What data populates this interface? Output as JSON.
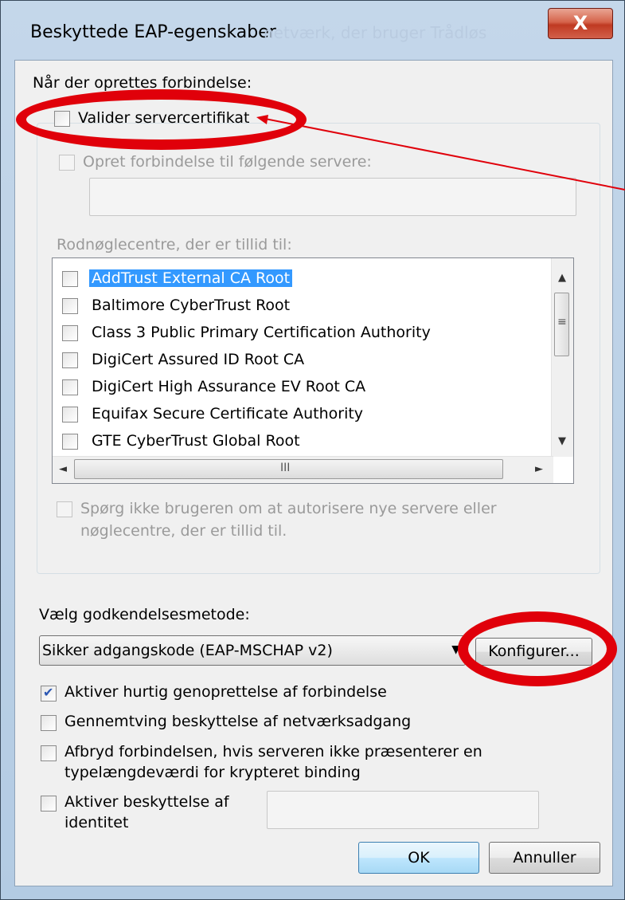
{
  "window": {
    "title": "Beskyttede EAP-egenskaber",
    "close_label": "X",
    "background_hint": "netværk, der bruger Trådløs"
  },
  "connect_section": {
    "heading": "Når der oprettes forbindelse:",
    "validate_cert": {
      "label": "Valider servercertifikat",
      "checked": false
    },
    "connect_servers": {
      "label": "Opret forbindelse til følgende servere:",
      "checked": false,
      "value": ""
    },
    "root_ca_label": "Rodnøglecentre, der er tillid til:",
    "root_cas": [
      {
        "label": "AddTrust External CA Root",
        "checked": false,
        "selected": true
      },
      {
        "label": "Baltimore CyberTrust Root",
        "checked": false,
        "selected": false
      },
      {
        "label": "Class 3 Public Primary Certification Authority",
        "checked": false,
        "selected": false
      },
      {
        "label": "DigiCert Assured ID Root CA",
        "checked": false,
        "selected": false
      },
      {
        "label": "DigiCert High Assurance EV Root CA",
        "checked": false,
        "selected": false
      },
      {
        "label": "Equifax Secure Certificate Authority",
        "checked": false,
        "selected": false
      },
      {
        "label": "GTE CyberTrust Global Root",
        "checked": false,
        "selected": false
      }
    ],
    "dont_prompt": {
      "line1": "Spørg ikke brugeren om at autorisere nye servere eller",
      "line2": "nøglecentre, der er tillid til.",
      "checked": false
    }
  },
  "auth_method": {
    "label": "Vælg godkendelsesmetode:",
    "selected": "Sikker adgangskode (EAP-MSCHAP v2)",
    "configure_label": "Konfigurer..."
  },
  "options": {
    "fast_reconnect": {
      "label": "Aktiver hurtig genoprettelse af forbindelse",
      "checked": true
    },
    "nap": {
      "label": "Gennemtving beskyttelse af netværksadgang",
      "checked": false
    },
    "crypto_binding": {
      "line1": "Afbryd forbindelsen, hvis serveren ikke præsenterer en",
      "line2": "typelængdeværdi for krypteret binding",
      "checked": false
    },
    "identity_privacy": {
      "line1": "Aktiver beskyttelse af",
      "line2": "identitet",
      "checked": false,
      "value": ""
    }
  },
  "buttons": {
    "ok": "OK",
    "cancel": "Annuller"
  },
  "scroll": {
    "up": "▲",
    "down": "▼",
    "left": "◄",
    "right": "►",
    "grip_v": "≡",
    "grip_h": "III"
  },
  "colors": {
    "highlight": "#e0000a",
    "selection": "#3399ff"
  }
}
